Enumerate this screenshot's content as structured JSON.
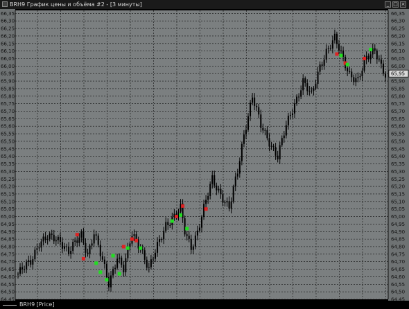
{
  "window": {
    "title": "BRH9 График цены и объёма #2 - [3 минуты]",
    "minimize": "_",
    "maximize": "□",
    "close": "×"
  },
  "colors": {
    "chart_background": "#7b7f80",
    "gridline": "#111111",
    "candle": "#000000",
    "buy_marker": "#22dd22",
    "sell_marker": "#dd2222"
  },
  "footer": {
    "legend_label": "BRH9 [Price]"
  },
  "chart_data": {
    "type": "candlestick",
    "series_name": "BRH9 [Price]",
    "ylim": [
      64.45,
      66.37
    ],
    "y_ticks": [
      "66,35",
      "66,30",
      "66,25",
      "66,20",
      "66,15",
      "66,10",
      "66,05",
      "66,00",
      "65,95",
      "65,90",
      "65,85",
      "65,80",
      "65,75",
      "65,70",
      "65,65",
      "65,60",
      "65,55",
      "65,50",
      "65,45",
      "65,40",
      "65,35",
      "65,30",
      "65,25",
      "65,20",
      "65,15",
      "65,10",
      "65,05",
      "65,00",
      "64,95",
      "64,90",
      "64,85",
      "64,80",
      "64,75",
      "64,70",
      "64,65",
      "64,60",
      "64,55",
      "64,50",
      "64,45"
    ],
    "current_price_label": "65,95",
    "current_price": 65.95,
    "grid": true,
    "candle_count": 175,
    "key_points": [
      {
        "i": 0,
        "p": 64.62
      },
      {
        "i": 6,
        "p": 64.7
      },
      {
        "i": 10,
        "p": 64.83
      },
      {
        "i": 14,
        "p": 64.86
      },
      {
        "i": 20,
        "p": 64.84
      },
      {
        "i": 24,
        "p": 64.77
      },
      {
        "i": 30,
        "p": 64.87
      },
      {
        "i": 33,
        "p": 64.75
      },
      {
        "i": 36,
        "p": 64.9
      },
      {
        "i": 40,
        "p": 64.7
      },
      {
        "i": 43,
        "p": 64.55
      },
      {
        "i": 47,
        "p": 64.74
      },
      {
        "i": 50,
        "p": 64.65
      },
      {
        "i": 54,
        "p": 64.88
      },
      {
        "i": 58,
        "p": 64.8
      },
      {
        "i": 62,
        "p": 64.65
      },
      {
        "i": 66,
        "p": 64.8
      },
      {
        "i": 70,
        "p": 64.95
      },
      {
        "i": 74,
        "p": 65.0
      },
      {
        "i": 77,
        "p": 65.05
      },
      {
        "i": 79,
        "p": 64.9
      },
      {
        "i": 82,
        "p": 64.8
      },
      {
        "i": 85,
        "p": 64.9
      },
      {
        "i": 88,
        "p": 65.05
      },
      {
        "i": 92,
        "p": 65.25
      },
      {
        "i": 96,
        "p": 65.15
      },
      {
        "i": 100,
        "p": 65.05
      },
      {
        "i": 104,
        "p": 65.3
      },
      {
        "i": 107,
        "p": 65.55
      },
      {
        "i": 111,
        "p": 65.8
      },
      {
        "i": 115,
        "p": 65.6
      },
      {
        "i": 119,
        "p": 65.5
      },
      {
        "i": 123,
        "p": 65.4
      },
      {
        "i": 127,
        "p": 65.6
      },
      {
        "i": 131,
        "p": 65.75
      },
      {
        "i": 135,
        "p": 65.9
      },
      {
        "i": 139,
        "p": 65.8
      },
      {
        "i": 143,
        "p": 66.0
      },
      {
        "i": 146,
        "p": 66.1
      },
      {
        "i": 150,
        "p": 66.18
      },
      {
        "i": 153,
        "p": 66.08
      },
      {
        "i": 157,
        "p": 65.95
      },
      {
        "i": 161,
        "p": 65.9
      },
      {
        "i": 165,
        "p": 66.05
      },
      {
        "i": 169,
        "p": 66.12
      },
      {
        "i": 172,
        "p": 66.0
      },
      {
        "i": 174,
        "p": 65.93
      }
    ],
    "markers": [
      {
        "i": 28,
        "p": 64.88,
        "kind": "sell"
      },
      {
        "i": 31,
        "p": 64.72,
        "kind": "sell"
      },
      {
        "i": 37,
        "p": 64.69,
        "kind": "buy"
      },
      {
        "i": 39,
        "p": 64.63,
        "kind": "buy"
      },
      {
        "i": 42,
        "p": 64.58,
        "kind": "buy"
      },
      {
        "i": 45,
        "p": 64.74,
        "kind": "buy"
      },
      {
        "i": 48,
        "p": 64.62,
        "kind": "buy"
      },
      {
        "i": 50,
        "p": 64.8,
        "kind": "sell"
      },
      {
        "i": 52,
        "p": 64.79,
        "kind": "buy"
      },
      {
        "i": 54,
        "p": 64.85,
        "kind": "sell"
      },
      {
        "i": 56,
        "p": 64.84,
        "kind": "sell"
      },
      {
        "i": 58,
        "p": 64.79,
        "kind": "buy"
      },
      {
        "i": 73,
        "p": 64.97,
        "kind": "buy"
      },
      {
        "i": 75,
        "p": 65.0,
        "kind": "sell"
      },
      {
        "i": 77,
        "p": 65.01,
        "kind": "buy"
      },
      {
        "i": 78,
        "p": 65.07,
        "kind": "sell"
      },
      {
        "i": 80,
        "p": 64.92,
        "kind": "buy"
      },
      {
        "i": 89,
        "p": 65.05,
        "kind": "sell"
      },
      {
        "i": 151,
        "p": 66.08,
        "kind": "sell"
      },
      {
        "i": 153,
        "p": 66.07,
        "kind": "buy"
      },
      {
        "i": 155,
        "p": 66.02,
        "kind": "sell"
      },
      {
        "i": 156,
        "p": 66.01,
        "kind": "buy"
      },
      {
        "i": 164,
        "p": 66.05,
        "kind": "sell"
      },
      {
        "i": 167,
        "p": 66.11,
        "kind": "buy"
      }
    ]
  }
}
